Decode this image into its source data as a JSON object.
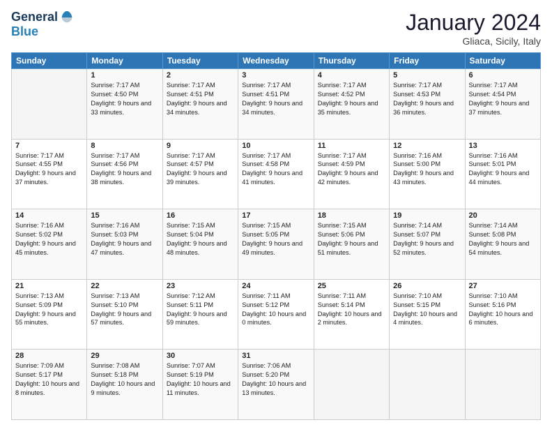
{
  "header": {
    "logo_line1": "General",
    "logo_line2": "Blue",
    "calendar_title": "January 2024",
    "calendar_subtitle": "Gliaca, Sicily, Italy"
  },
  "days_of_week": [
    "Sunday",
    "Monday",
    "Tuesday",
    "Wednesday",
    "Thursday",
    "Friday",
    "Saturday"
  ],
  "weeks": [
    [
      {
        "day": "",
        "sunrise": "",
        "sunset": "",
        "daylight": ""
      },
      {
        "day": "1",
        "sunrise": "Sunrise: 7:17 AM",
        "sunset": "Sunset: 4:50 PM",
        "daylight": "Daylight: 9 hours and 33 minutes."
      },
      {
        "day": "2",
        "sunrise": "Sunrise: 7:17 AM",
        "sunset": "Sunset: 4:51 PM",
        "daylight": "Daylight: 9 hours and 34 minutes."
      },
      {
        "day": "3",
        "sunrise": "Sunrise: 7:17 AM",
        "sunset": "Sunset: 4:51 PM",
        "daylight": "Daylight: 9 hours and 34 minutes."
      },
      {
        "day": "4",
        "sunrise": "Sunrise: 7:17 AM",
        "sunset": "Sunset: 4:52 PM",
        "daylight": "Daylight: 9 hours and 35 minutes."
      },
      {
        "day": "5",
        "sunrise": "Sunrise: 7:17 AM",
        "sunset": "Sunset: 4:53 PM",
        "daylight": "Daylight: 9 hours and 36 minutes."
      },
      {
        "day": "6",
        "sunrise": "Sunrise: 7:17 AM",
        "sunset": "Sunset: 4:54 PM",
        "daylight": "Daylight: 9 hours and 37 minutes."
      }
    ],
    [
      {
        "day": "7",
        "sunrise": "Sunrise: 7:17 AM",
        "sunset": "Sunset: 4:55 PM",
        "daylight": "Daylight: 9 hours and 37 minutes."
      },
      {
        "day": "8",
        "sunrise": "Sunrise: 7:17 AM",
        "sunset": "Sunset: 4:56 PM",
        "daylight": "Daylight: 9 hours and 38 minutes."
      },
      {
        "day": "9",
        "sunrise": "Sunrise: 7:17 AM",
        "sunset": "Sunset: 4:57 PM",
        "daylight": "Daylight: 9 hours and 39 minutes."
      },
      {
        "day": "10",
        "sunrise": "Sunrise: 7:17 AM",
        "sunset": "Sunset: 4:58 PM",
        "daylight": "Daylight: 9 hours and 41 minutes."
      },
      {
        "day": "11",
        "sunrise": "Sunrise: 7:17 AM",
        "sunset": "Sunset: 4:59 PM",
        "daylight": "Daylight: 9 hours and 42 minutes."
      },
      {
        "day": "12",
        "sunrise": "Sunrise: 7:16 AM",
        "sunset": "Sunset: 5:00 PM",
        "daylight": "Daylight: 9 hours and 43 minutes."
      },
      {
        "day": "13",
        "sunrise": "Sunrise: 7:16 AM",
        "sunset": "Sunset: 5:01 PM",
        "daylight": "Daylight: 9 hours and 44 minutes."
      }
    ],
    [
      {
        "day": "14",
        "sunrise": "Sunrise: 7:16 AM",
        "sunset": "Sunset: 5:02 PM",
        "daylight": "Daylight: 9 hours and 45 minutes."
      },
      {
        "day": "15",
        "sunrise": "Sunrise: 7:16 AM",
        "sunset": "Sunset: 5:03 PM",
        "daylight": "Daylight: 9 hours and 47 minutes."
      },
      {
        "day": "16",
        "sunrise": "Sunrise: 7:15 AM",
        "sunset": "Sunset: 5:04 PM",
        "daylight": "Daylight: 9 hours and 48 minutes."
      },
      {
        "day": "17",
        "sunrise": "Sunrise: 7:15 AM",
        "sunset": "Sunset: 5:05 PM",
        "daylight": "Daylight: 9 hours and 49 minutes."
      },
      {
        "day": "18",
        "sunrise": "Sunrise: 7:15 AM",
        "sunset": "Sunset: 5:06 PM",
        "daylight": "Daylight: 9 hours and 51 minutes."
      },
      {
        "day": "19",
        "sunrise": "Sunrise: 7:14 AM",
        "sunset": "Sunset: 5:07 PM",
        "daylight": "Daylight: 9 hours and 52 minutes."
      },
      {
        "day": "20",
        "sunrise": "Sunrise: 7:14 AM",
        "sunset": "Sunset: 5:08 PM",
        "daylight": "Daylight: 9 hours and 54 minutes."
      }
    ],
    [
      {
        "day": "21",
        "sunrise": "Sunrise: 7:13 AM",
        "sunset": "Sunset: 5:09 PM",
        "daylight": "Daylight: 9 hours and 55 minutes."
      },
      {
        "day": "22",
        "sunrise": "Sunrise: 7:13 AM",
        "sunset": "Sunset: 5:10 PM",
        "daylight": "Daylight: 9 hours and 57 minutes."
      },
      {
        "day": "23",
        "sunrise": "Sunrise: 7:12 AM",
        "sunset": "Sunset: 5:11 PM",
        "daylight": "Daylight: 9 hours and 59 minutes."
      },
      {
        "day": "24",
        "sunrise": "Sunrise: 7:11 AM",
        "sunset": "Sunset: 5:12 PM",
        "daylight": "Daylight: 10 hours and 0 minutes."
      },
      {
        "day": "25",
        "sunrise": "Sunrise: 7:11 AM",
        "sunset": "Sunset: 5:14 PM",
        "daylight": "Daylight: 10 hours and 2 minutes."
      },
      {
        "day": "26",
        "sunrise": "Sunrise: 7:10 AM",
        "sunset": "Sunset: 5:15 PM",
        "daylight": "Daylight: 10 hours and 4 minutes."
      },
      {
        "day": "27",
        "sunrise": "Sunrise: 7:10 AM",
        "sunset": "Sunset: 5:16 PM",
        "daylight": "Daylight: 10 hours and 6 minutes."
      }
    ],
    [
      {
        "day": "28",
        "sunrise": "Sunrise: 7:09 AM",
        "sunset": "Sunset: 5:17 PM",
        "daylight": "Daylight: 10 hours and 8 minutes."
      },
      {
        "day": "29",
        "sunrise": "Sunrise: 7:08 AM",
        "sunset": "Sunset: 5:18 PM",
        "daylight": "Daylight: 10 hours and 9 minutes."
      },
      {
        "day": "30",
        "sunrise": "Sunrise: 7:07 AM",
        "sunset": "Sunset: 5:19 PM",
        "daylight": "Daylight: 10 hours and 11 minutes."
      },
      {
        "day": "31",
        "sunrise": "Sunrise: 7:06 AM",
        "sunset": "Sunset: 5:20 PM",
        "daylight": "Daylight: 10 hours and 13 minutes."
      },
      {
        "day": "",
        "sunrise": "",
        "sunset": "",
        "daylight": ""
      },
      {
        "day": "",
        "sunrise": "",
        "sunset": "",
        "daylight": ""
      },
      {
        "day": "",
        "sunrise": "",
        "sunset": "",
        "daylight": ""
      }
    ]
  ]
}
